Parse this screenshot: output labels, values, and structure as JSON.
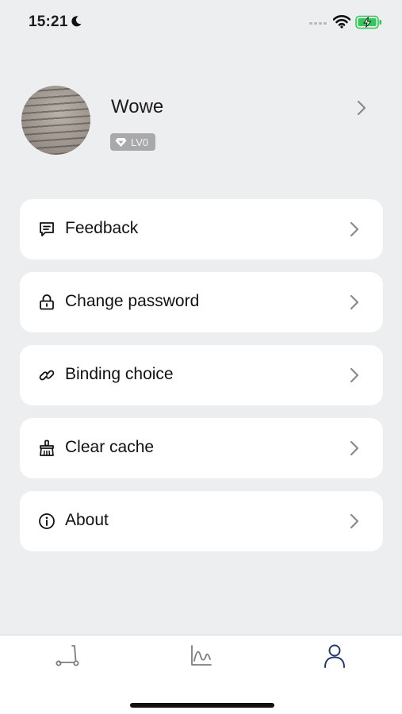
{
  "status_bar": {
    "time": "15:21",
    "icons": [
      "moon-icon",
      "signal-icon",
      "wifi-icon",
      "battery-charging-icon"
    ],
    "battery_color": "#35c759"
  },
  "profile": {
    "name": "Wowe",
    "level": "LV0",
    "level_icon": "diamond-icon"
  },
  "menu": [
    {
      "label": "Feedback",
      "icon": "feedback-icon"
    },
    {
      "label": "Change password",
      "icon": "lock-icon"
    },
    {
      "label": "Binding choice",
      "icon": "link-icon"
    },
    {
      "label": "Clear cache",
      "icon": "broom-icon"
    },
    {
      "label": "About",
      "icon": "info-icon"
    }
  ],
  "tab_bar": {
    "tabs": [
      {
        "name": "scooter",
        "icon": "scooter-icon",
        "active": false
      },
      {
        "name": "stats",
        "icon": "chart-icon",
        "active": false
      },
      {
        "name": "profile",
        "icon": "person-icon",
        "active": true
      }
    ],
    "active_color": "#1f3b6e",
    "inactive_color": "#7a7d82"
  }
}
